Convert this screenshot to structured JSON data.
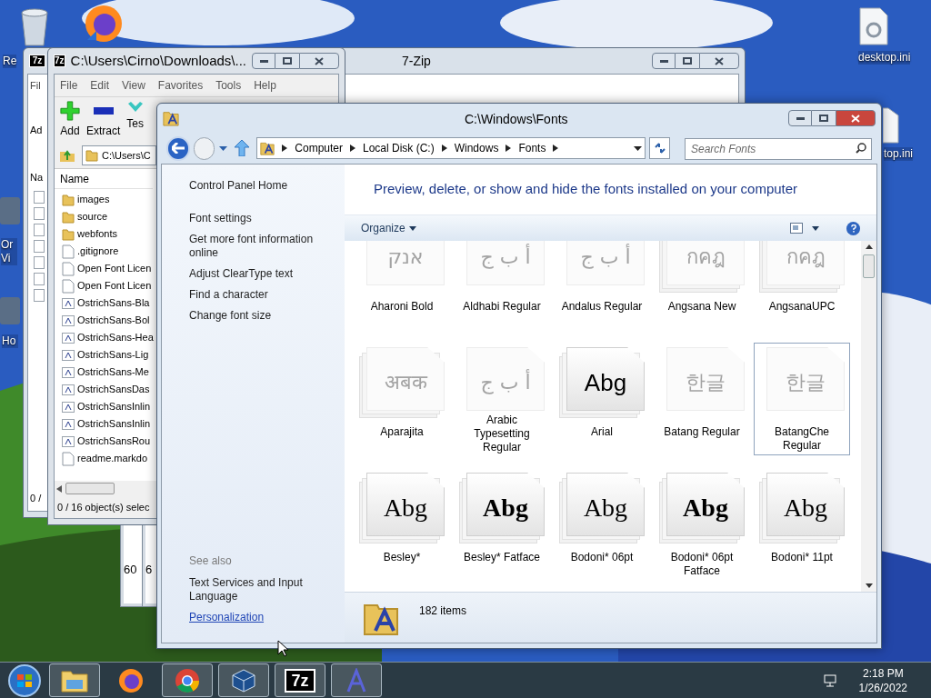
{
  "desktop_icons": [
    {
      "kind": "recycle-bin",
      "label": "Re"
    },
    {
      "kind": "firefox-shortcut"
    },
    {
      "kind": "app",
      "label": "Or Vi"
    },
    {
      "kind": "app",
      "label": "Ho"
    },
    {
      "kind": "settings-file",
      "label": "desktop.ini"
    },
    {
      "kind": "settings-file",
      "label": "top.ini"
    }
  ],
  "back_window": {
    "title": "7-Zip",
    "icon_text": "7z",
    "menu_fragment": "Fil",
    "toolbar_fragment": "Ad",
    "column_fragment": "Na",
    "status_fragment": "0 /"
  },
  "other_windows": [
    {
      "text": "60"
    },
    {
      "text": "6"
    }
  ],
  "zip_window": {
    "title": "C:\\Users\\Cirno\\Downloads\\...",
    "icon_text": "7z",
    "menu": [
      "File",
      "Edit",
      "View",
      "Favorites",
      "Tools",
      "Help"
    ],
    "toolbar": [
      {
        "kind": "add",
        "label": "Add"
      },
      {
        "kind": "extract",
        "label": "Extract"
      },
      {
        "kind": "test",
        "label": "Tes"
      }
    ],
    "path": "C:\\Users\\C",
    "column": "Name",
    "files": [
      {
        "kind": "folder",
        "name": "images"
      },
      {
        "kind": "folder",
        "name": "source"
      },
      {
        "kind": "folder",
        "name": "webfonts"
      },
      {
        "kind": "file",
        "name": ".gitignore"
      },
      {
        "kind": "file",
        "name": "Open Font Licen"
      },
      {
        "kind": "file",
        "name": "Open Font Licen"
      },
      {
        "kind": "font",
        "name": "OstrichSans-Bla"
      },
      {
        "kind": "font",
        "name": "OstrichSans-Bol"
      },
      {
        "kind": "font",
        "name": "OstrichSans-Hea"
      },
      {
        "kind": "font",
        "name": "OstrichSans-Lig"
      },
      {
        "kind": "font",
        "name": "OstrichSans-Me"
      },
      {
        "kind": "font",
        "name": "OstrichSansDas"
      },
      {
        "kind": "font",
        "name": "OstrichSansInlin"
      },
      {
        "kind": "font",
        "name": "OstrichSansInlin"
      },
      {
        "kind": "font",
        "name": "OstrichSansRou"
      },
      {
        "kind": "file",
        "name": "readme.markdo"
      }
    ],
    "status": "0 / 16 object(s) selec"
  },
  "fonts_window": {
    "title": "C:\\Windows\\Fonts",
    "breadcrumbs": [
      "Computer",
      "Local Disk (C:)",
      "Windows",
      "Fonts"
    ],
    "search": {
      "placeholder": "Search Fonts"
    },
    "tasks": [
      {
        "label": "Control Panel Home"
      },
      {
        "label": "Font settings"
      },
      {
        "label": "Get more font information online"
      },
      {
        "label": "Adjust ClearType text"
      },
      {
        "label": "Find a character"
      },
      {
        "label": "Change font size"
      }
    ],
    "see_also": {
      "heading": "See also",
      "links": [
        {
          "kind": "task",
          "label": "Text Services and Input Language"
        },
        {
          "kind": "link",
          "label": "Personalization"
        }
      ]
    },
    "heading": "Preview, delete, or show and hide the fonts installed on your computer",
    "organize": "Organize",
    "fonts": [
      {
        "name": "Aharoni Bold",
        "sample": "אנק",
        "kind": "faded",
        "stacked": false,
        "selected": false
      },
      {
        "name": "Aldhabi Regular",
        "sample": "أ ب ج",
        "kind": "faded",
        "stacked": false,
        "selected": false
      },
      {
        "name": "Andalus Regular",
        "sample": "أ ب ج",
        "kind": "faded",
        "stacked": false,
        "selected": false
      },
      {
        "name": "Angsana New",
        "sample": "กคฎ",
        "kind": "faded",
        "stacked": true,
        "selected": false
      },
      {
        "name": "AngsanaUPC",
        "sample": "กคฎ",
        "kind": "faded",
        "stacked": true,
        "selected": false
      },
      {
        "name": "Aparajita",
        "sample": "अबक",
        "kind": "faded",
        "stacked": true,
        "selected": false
      },
      {
        "name": "Arabic Typesetting Regular",
        "sample": "أ ب ج",
        "kind": "faded",
        "stacked": false,
        "selected": false
      },
      {
        "name": "Arial",
        "sample": "Abg",
        "kind": "sans",
        "stacked": true,
        "selected": false
      },
      {
        "name": "Batang Regular",
        "sample": "한글",
        "kind": "faded",
        "stacked": false,
        "selected": false
      },
      {
        "name": "BatangChe Regular",
        "sample": "한글",
        "kind": "faded",
        "stacked": false,
        "selected": true
      },
      {
        "name": "Besley*",
        "sample": "Abg",
        "kind": "serif",
        "stacked": true,
        "selected": false
      },
      {
        "name": "Besley* Fatface",
        "sample": "Abg",
        "kind": "serif-bold",
        "stacked": true,
        "selected": false
      },
      {
        "name": "Bodoni* 06pt",
        "sample": "Abg",
        "kind": "serif",
        "stacked": true,
        "selected": false
      },
      {
        "name": "Bodoni* 06pt Fatface",
        "sample": "Abg",
        "kind": "serif-bold",
        "stacked": true,
        "selected": false
      },
      {
        "name": "Bodoni* 11pt",
        "sample": "Abg",
        "kind": "serif",
        "stacked": true,
        "selected": false
      }
    ],
    "count": "182 items"
  },
  "taskbar": {
    "items": [
      {
        "kind": "explorer",
        "running": true
      },
      {
        "kind": "firefox",
        "running": false
      },
      {
        "kind": "chrome",
        "running": true
      },
      {
        "kind": "virtualbox",
        "running": true
      },
      {
        "kind": "sevenzip",
        "running": true,
        "icon_text": "7z"
      },
      {
        "kind": "fonts",
        "running": true
      }
    ],
    "time": "2:18 PM",
    "date": "1/26/2022"
  }
}
